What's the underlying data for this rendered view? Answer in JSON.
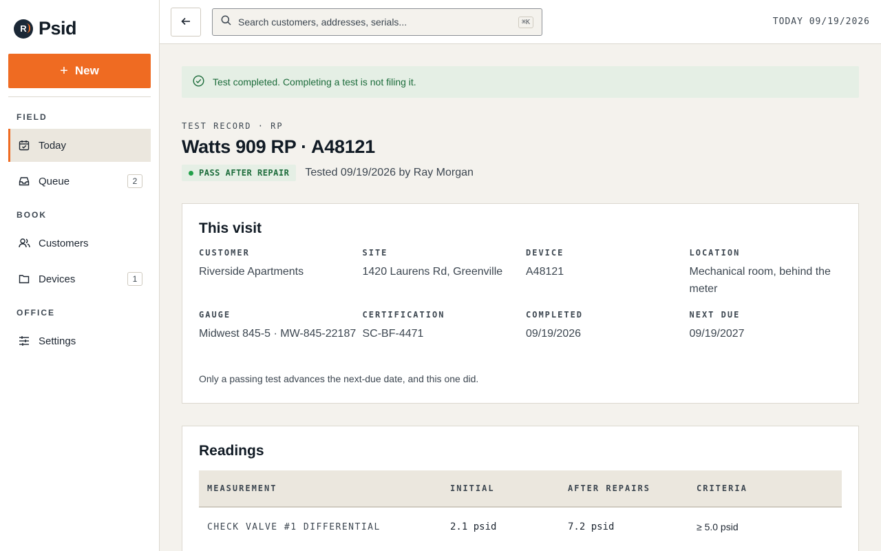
{
  "app": {
    "name": "Psid",
    "logo_letter": "R"
  },
  "sidebar": {
    "new_label": "New",
    "sections": [
      {
        "label": "FIELD"
      },
      {
        "label": "BOOK"
      },
      {
        "label": "OFFICE"
      }
    ],
    "items": [
      {
        "label": "Today",
        "icon": "calendar-check-icon",
        "active": true
      },
      {
        "label": "Queue",
        "icon": "inbox-icon",
        "badge": "2"
      },
      {
        "label": "Customers",
        "icon": "users-icon"
      },
      {
        "label": "Devices",
        "icon": "folder-icon",
        "badge": "1"
      },
      {
        "label": "Settings",
        "icon": "sliders-icon"
      }
    ]
  },
  "topbar": {
    "search_placeholder": "Search customers, addresses, serials...",
    "search_shortcut": "⌘K",
    "today": "TODAY 09/19/2026"
  },
  "alert": {
    "message": "Test completed. Completing a test is not filing it."
  },
  "record": {
    "eyebrow": "TEST RECORD · RP",
    "title": "Watts 909 RP · A48121",
    "status": "PASS AFTER REPAIR",
    "tested": "Tested 09/19/2026 by Ray Morgan"
  },
  "visit": {
    "title": "This visit",
    "fields": [
      {
        "label": "CUSTOMER",
        "value": "Riverside Apartments"
      },
      {
        "label": "SITE",
        "value": "1420 Laurens Rd, Greenville"
      },
      {
        "label": "DEVICE",
        "value": "A48121"
      },
      {
        "label": "LOCATION",
        "value": "Mechanical room, behind the meter"
      },
      {
        "label": "GAUGE",
        "value": "Midwest 845-5 · MW-845-22187"
      },
      {
        "label": "CERTIFICATION",
        "value": "SC-BF-4471"
      },
      {
        "label": "COMPLETED",
        "value": "09/19/2026"
      },
      {
        "label": "NEXT DUE",
        "value": "09/19/2027"
      }
    ],
    "note": "Only a passing test advances the next-due date, and this one did."
  },
  "readings": {
    "title": "Readings",
    "columns": [
      "MEASUREMENT",
      "INITIAL",
      "AFTER REPAIRS",
      "CRITERIA"
    ],
    "rows": [
      [
        "CHECK VALVE #1 DIFFERENTIAL",
        "2.1 psid",
        "7.2 psid",
        "≥ 5.0 psid"
      ]
    ]
  },
  "colors": {
    "accent": "#ef6b22",
    "success": "#1b6b3a",
    "navy": "#1b2836"
  }
}
